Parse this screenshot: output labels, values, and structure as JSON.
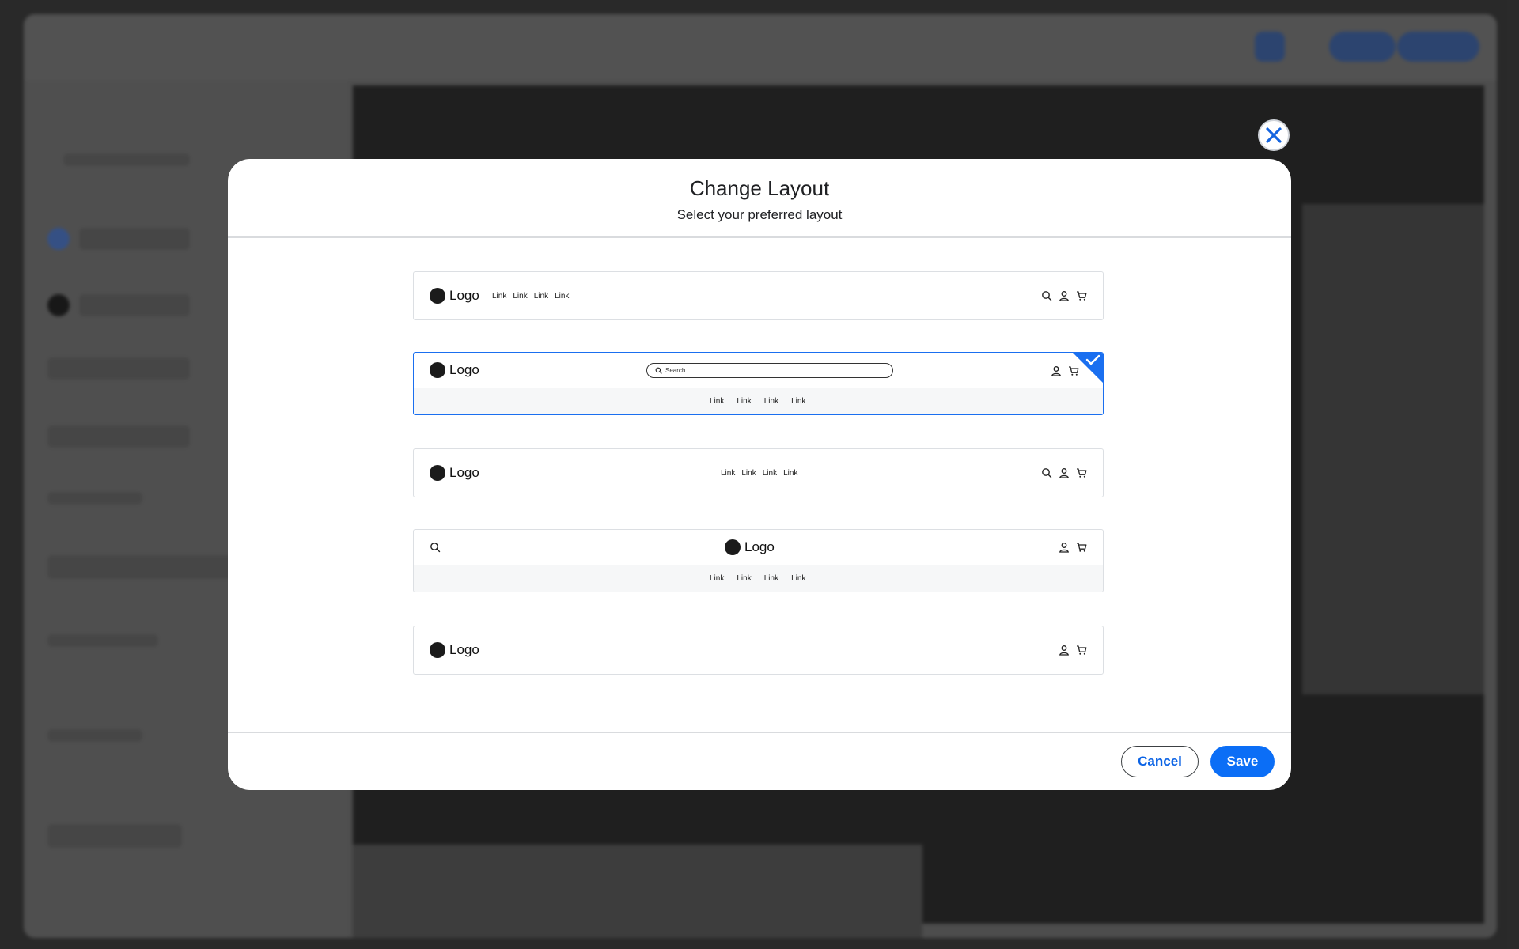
{
  "modal": {
    "title": "Change Layout",
    "subtitle": "Select your preferred layout"
  },
  "layouts": [
    {
      "logo": "Logo",
      "links": [
        "Link",
        "Link",
        "Link",
        "Link"
      ],
      "icons": [
        "search-icon",
        "user-icon",
        "cart-icon"
      ],
      "selected": false
    },
    {
      "logo": "Logo",
      "search_placeholder": "Search",
      "links": [
        "Link",
        "Link",
        "Link",
        "Link"
      ],
      "icons": [
        "user-icon",
        "cart-icon"
      ],
      "selected": true
    },
    {
      "logo": "Logo",
      "links": [
        "Link",
        "Link",
        "Link",
        "Link"
      ],
      "icons": [
        "search-icon",
        "user-icon",
        "cart-icon"
      ],
      "selected": false
    },
    {
      "logo": "Logo",
      "links": [
        "Link",
        "Link",
        "Link",
        "Link"
      ],
      "icons": [
        "search-icon",
        "user-icon",
        "cart-icon"
      ],
      "selected": false
    },
    {
      "logo": "Logo",
      "icons": [
        "user-icon",
        "cart-icon"
      ],
      "selected": false
    }
  ],
  "footer": {
    "cancel_label": "Cancel",
    "save_label": "Save"
  },
  "colors": {
    "accent": "#0b6ef6",
    "selected_border": "#1a6ff0"
  }
}
